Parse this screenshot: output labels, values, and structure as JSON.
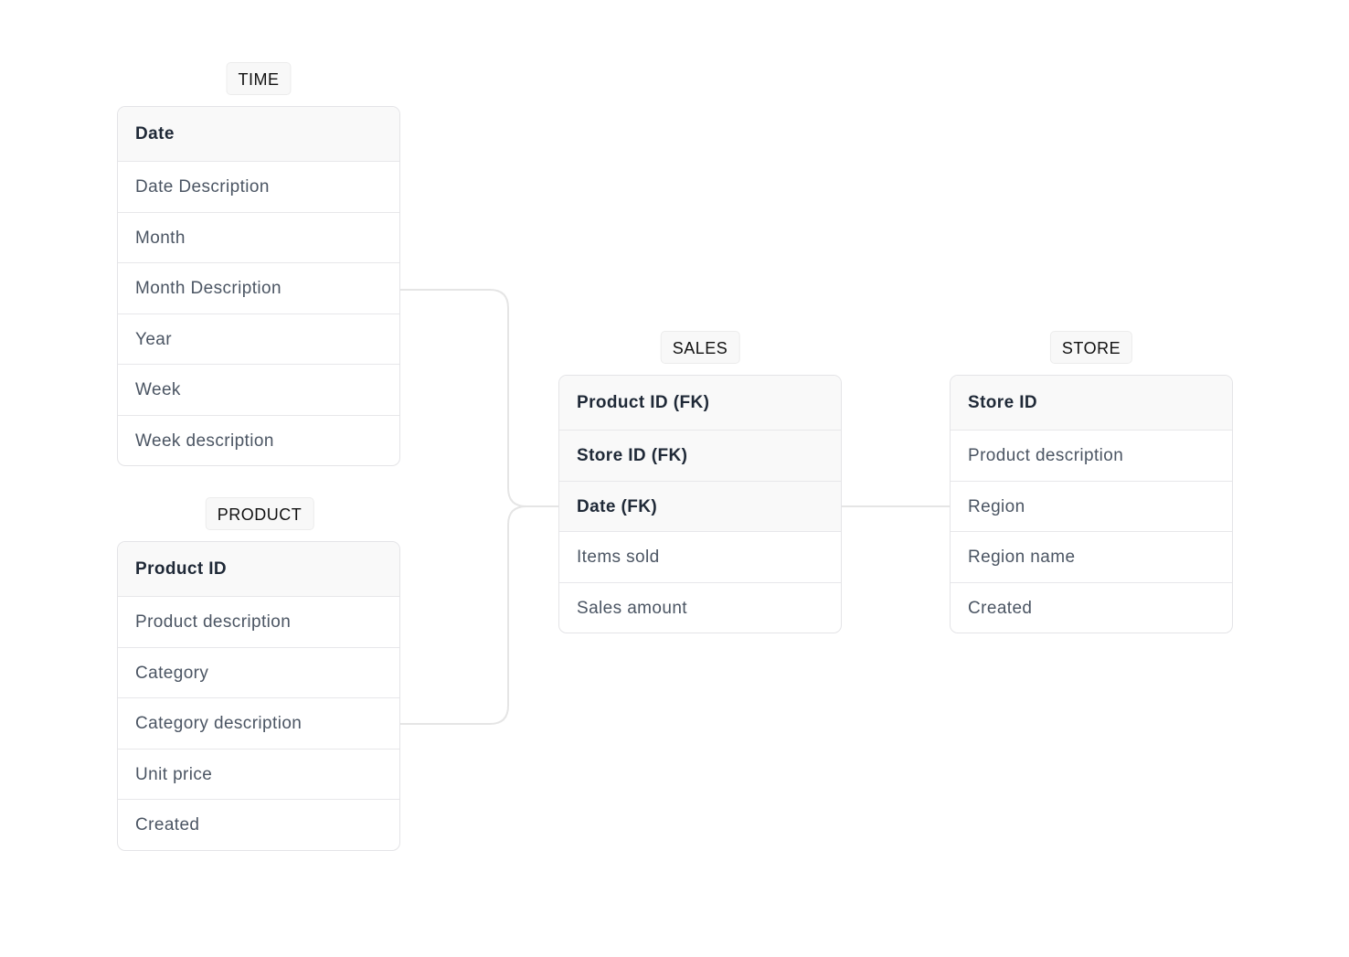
{
  "tables": {
    "time": {
      "title": "TIME",
      "rows": [
        {
          "label": "Date",
          "key": true
        },
        {
          "label": "Date Description",
          "key": false
        },
        {
          "label": "Month",
          "key": false
        },
        {
          "label": "Month Description",
          "key": false
        },
        {
          "label": "Year",
          "key": false
        },
        {
          "label": "Week",
          "key": false
        },
        {
          "label": "Week description",
          "key": false
        }
      ]
    },
    "product": {
      "title": "PRODUCT",
      "rows": [
        {
          "label": "Product ID",
          "key": true
        },
        {
          "label": "Product description",
          "key": false
        },
        {
          "label": "Category",
          "key": false
        },
        {
          "label": "Category description",
          "key": false
        },
        {
          "label": "Unit price",
          "key": false
        },
        {
          "label": "Created",
          "key": false
        }
      ]
    },
    "sales": {
      "title": "SALES",
      "rows": [
        {
          "label": "Product ID (FK)",
          "key": true
        },
        {
          "label": "Store ID (FK)",
          "key": true
        },
        {
          "label": "Date (FK)",
          "key": true
        },
        {
          "label": "Items sold",
          "key": false
        },
        {
          "label": "Sales amount",
          "key": false
        }
      ]
    },
    "store": {
      "title": "STORE",
      "rows": [
        {
          "label": "Store ID",
          "key": true
        },
        {
          "label": "Product description",
          "key": false
        },
        {
          "label": "Region",
          "key": false
        },
        {
          "label": "Region name",
          "key": false
        },
        {
          "label": "Created",
          "key": false
        }
      ]
    }
  },
  "colors": {
    "connector": "#e5e5e5",
    "header_bg": "#f9f9f9",
    "border": "#e4e4e7"
  }
}
